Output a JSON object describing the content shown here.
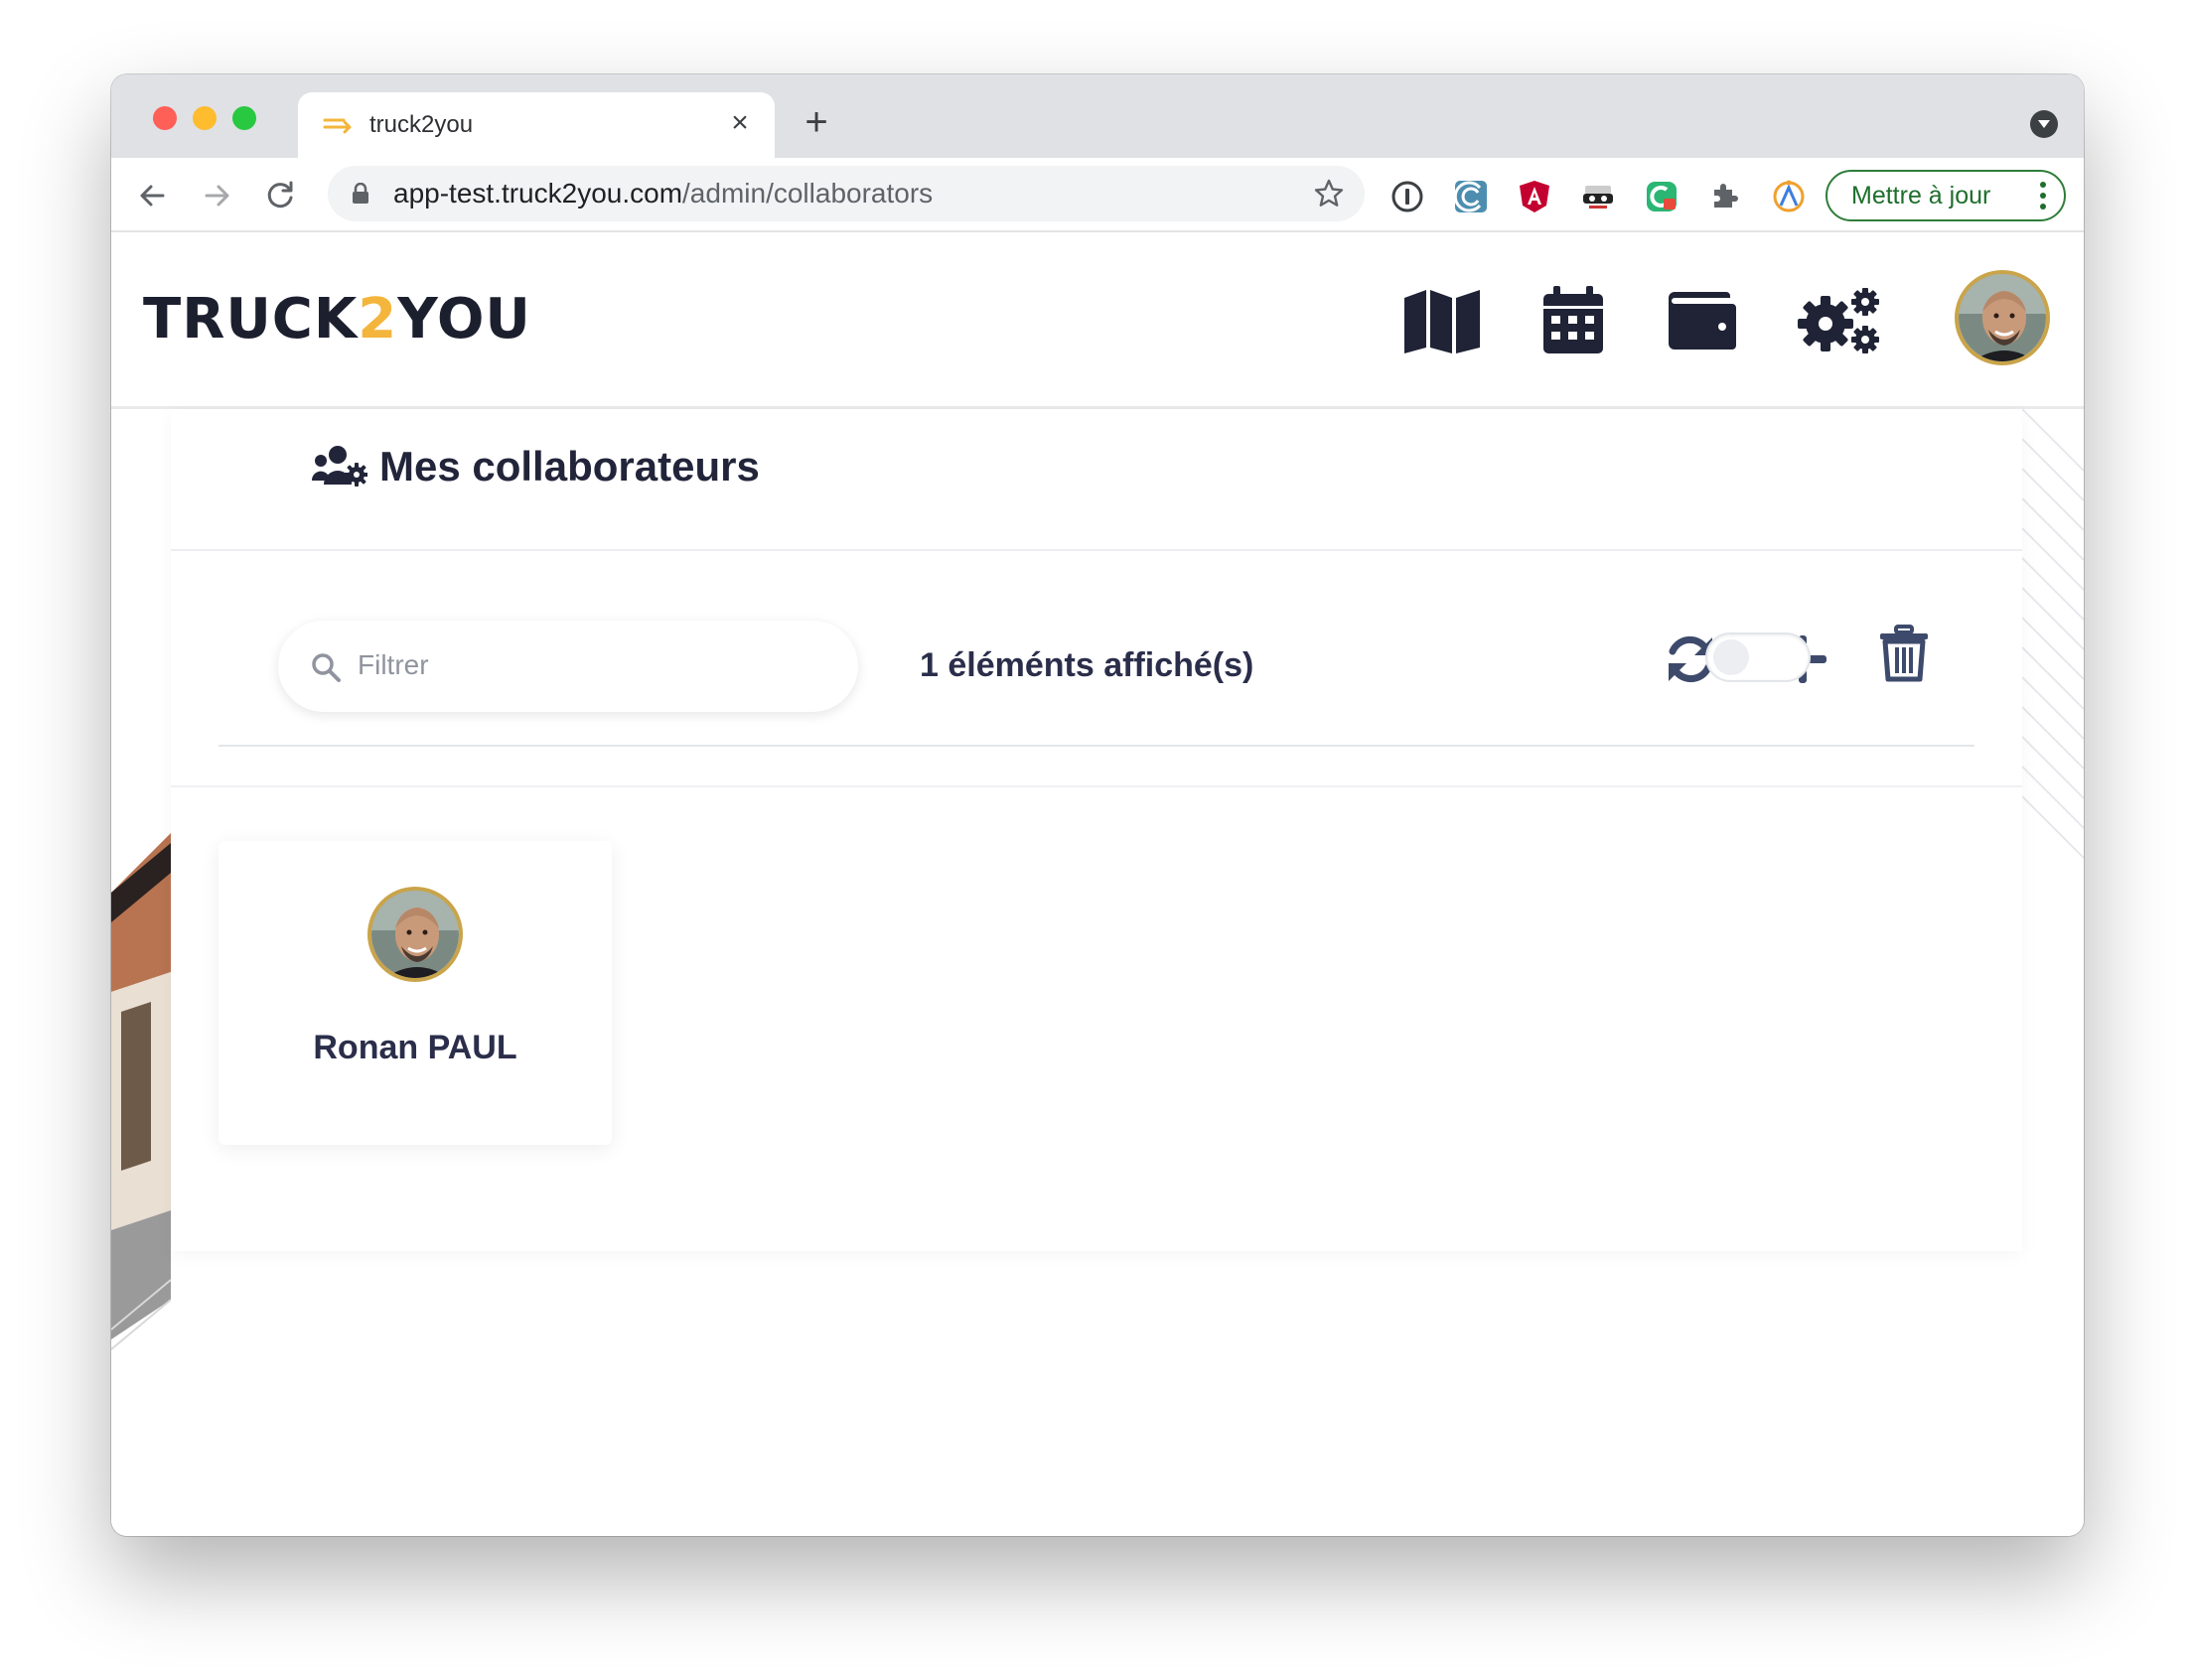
{
  "browser": {
    "tab_title": "truck2you",
    "tab_close_symbol": "×",
    "new_tab_symbol": "+",
    "url_host": "app-test.truck2you.com",
    "url_path": "/admin/collaborators",
    "update_button_label": "Mettre à jour",
    "extensions": [
      "1password-icon",
      "wave-extension-icon",
      "angular-devtools-icon",
      "incognito-extension-icon",
      "lock-extension-icon",
      "puzzle-extensions-icon",
      "rss-extension-icon"
    ]
  },
  "app": {
    "logo": {
      "part1": "TRUCK",
      "part2": "2",
      "part3": "YOU"
    },
    "nav_icons": [
      "map-icon",
      "calendar-icon",
      "wallet-icon",
      "gears-icon"
    ],
    "accent_color": "#f3b53c",
    "text_color": "#2b2e4a"
  },
  "page": {
    "title": "Mes collaborateurs",
    "filter": {
      "placeholder": "Filtrer",
      "value": ""
    },
    "count_text": "1 éléménts affiché(s)",
    "toggle_on": false,
    "collaborators": [
      {
        "name": "Ronan PAUL"
      }
    ]
  }
}
